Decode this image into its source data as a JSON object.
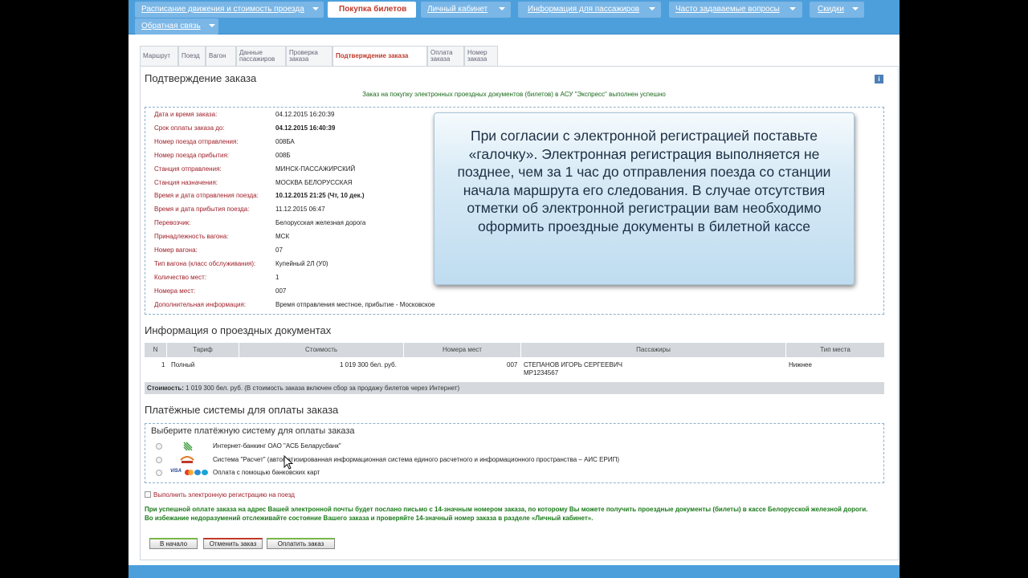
{
  "nav": {
    "items": [
      {
        "label": "Расписание движения и стоимость проезда",
        "active": false
      },
      {
        "label": "Покупка билетов",
        "active": true
      },
      {
        "label": "Личный кабинет",
        "active": false
      },
      {
        "label": "Информация для пассажиров",
        "active": false
      },
      {
        "label": "Часто задаваемые вопросы",
        "active": false
      },
      {
        "label": "Скидки",
        "active": false
      },
      {
        "label": "Обратная связь",
        "active": false
      }
    ]
  },
  "steps": [
    {
      "label": "Маршрут"
    },
    {
      "label": "Поезд"
    },
    {
      "label": "Вагон"
    },
    {
      "label": "Данные пассажиров"
    },
    {
      "label": "Проверка заказа"
    },
    {
      "label": "Подтверждение заказа",
      "active": true
    },
    {
      "label": "Оплата заказа"
    },
    {
      "label": "Номер заказа"
    }
  ],
  "page_title": "Подтверждение заказа",
  "info_icon_glyph": "i",
  "success_message": "Заказ на покупку электронных проездных документов (билетов) в АСУ \"Экспресс\" выполнен успешно",
  "order_details": [
    {
      "label": "Дата и время заказа:",
      "value": "04.12.2015 16:20:39"
    },
    {
      "label": "Срок оплаты заказа до:",
      "value": "04.12.2015 16:40:39",
      "bold": true
    },
    {
      "label": "Номер поезда отправления:",
      "value": "008БА"
    },
    {
      "label": "Номер поезда прибытия:",
      "value": "008Б"
    },
    {
      "label": "Станция отправления:",
      "value": "МИНСК-ПАССАЖИРСКИЙ"
    },
    {
      "label": "Станция назначения:",
      "value": "МОСКВА БЕЛОРУССКАЯ"
    },
    {
      "label": "Время и дата отправления поезда:",
      "value": "10.12.2015 21:25 (Чт, 10 дек.)",
      "bold": true
    },
    {
      "label": "Время и дата прибытия поезда:",
      "value": "11.12.2015 06:47"
    },
    {
      "label": "Перевозчик:",
      "value": "Белорусская железная дорога"
    },
    {
      "label": "Принадлежность вагона:",
      "value": "МСК"
    },
    {
      "label": "Номер вагона:",
      "value": "07"
    },
    {
      "label": "Тип вагона (класс обслуживания):",
      "value": "Купейный 2Л (У0)"
    },
    {
      "label": "Количество мест:",
      "value": "1"
    },
    {
      "label": "Номера мест:",
      "value": "007"
    },
    {
      "label": "Дополнительная информация:",
      "value": "Время отправления местное, прибытие - Московское"
    }
  ],
  "callout_text": "При согласии с электронной регистрацией поставьте «галочку». Электронная регистрация выполняется не позднее, чем за 1 час до отправления поезда со станции начала маршрута его следования. В случае отсутствия отметки об электронной регистрации вам необходимо оформить проездные документы в билетной кассе",
  "tickets_title": "Информация о проездных документах",
  "tickets": {
    "columns": [
      "N",
      "Тариф",
      "Стоимость",
      "Номера мест",
      "Пассажиры",
      "Тип места"
    ],
    "rows": [
      {
        "n": "1",
        "tariff": "Полный",
        "cost": "1 019 300 бел. руб.",
        "seats": "007",
        "passenger": "СТЕПАНОВ ИГОРЬ СЕРГЕЕВИЧ",
        "document": "МР1234567",
        "seat_type": "Нижнее"
      }
    ],
    "cost_label": "Стоимость:",
    "cost_text": " 1 019 300 бел. руб. (В стоимость заказа включен сбор за продажу билетов через Интернет)"
  },
  "payment_title": "Платёжные системы для оплаты заказа",
  "payment_subtitle": "Выберите платёжную систему для оплаты заказа",
  "payment_options": [
    {
      "label": "Интернет-банкинг ОАО \"АСБ Беларусбанк\"",
      "icon": "belarusbank-icon"
    },
    {
      "label": "Система \"Расчет\" (автоматизированная информационная система единого расчетного и информационного пространства – АИС ЕРИП)",
      "icon": "raschet-icon"
    },
    {
      "label": "Оплата с помощью банковских карт",
      "icon": "bank-cards-icon"
    }
  ],
  "card_logos": [
    "VISA"
  ],
  "ereg_label": "Выполнить электронную регистрацию на поезд",
  "notes": [
    "При успешной оплате заказа на адрес Вашей электронной почты будет послано письмо с 14-значным номером заказа, по которому Вы можете получить проездные документы (билеты) в кассе Белорусской железной дороги.",
    "Во избежание недоразумений отслеживайте состояние Вашего заказа и проверяйте 14-значный номер заказа в разделе «Личный кабинет»."
  ],
  "buttons": {
    "start": "В начало",
    "cancel": "Отменить заказ",
    "pay": "Оплатить заказ"
  },
  "colors": {
    "nav_bar": "#4d9fdc",
    "label_red": "#a0202a",
    "note_green": "#1a7a1a"
  }
}
